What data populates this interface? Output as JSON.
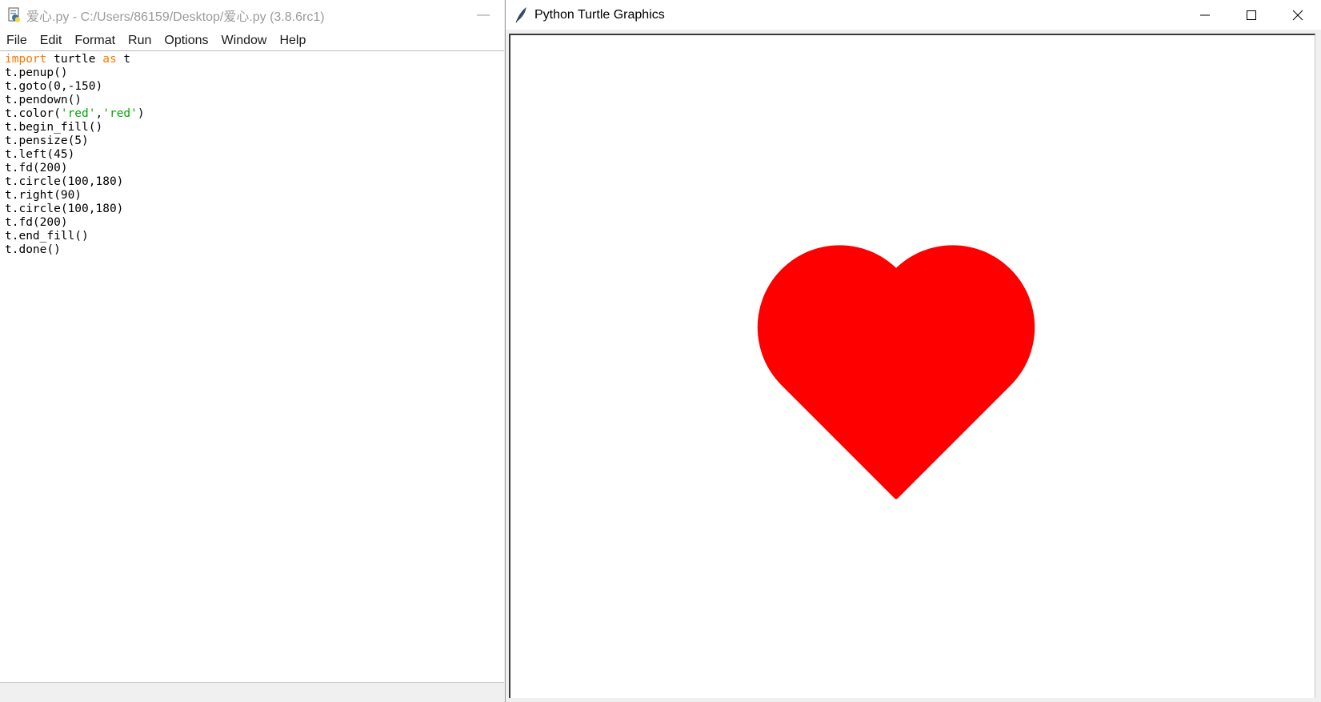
{
  "idle": {
    "window_title": "爱心.py - C:/Users/86159/Desktop/爱心.py (3.8.6rc1)",
    "minimize_glyph": "—",
    "menu": [
      "File",
      "Edit",
      "Format",
      "Run",
      "Options",
      "Window",
      "Help"
    ],
    "code": {
      "line1": {
        "kw1": "import",
        "mid": " turtle ",
        "kw2": "as",
        "end": " t"
      },
      "line2": "t.penup()",
      "line3": "t.goto(0,-150)",
      "line4": "t.pendown()",
      "line5": {
        "pre": "t.color(",
        "s1": "'red'",
        "comma": ",",
        "s2": "'red'",
        "post": ")"
      },
      "line6": "t.begin_fill()",
      "line7": "t.pensize(5)",
      "line8": "t.left(45)",
      "line9": "t.fd(200)",
      "line10": "t.circle(100,180)",
      "line11": "t.right(90)",
      "line12": "t.circle(100,180)",
      "line13": "t.fd(200)",
      "line14": "t.end_fill()",
      "line15": "t.done()"
    },
    "colors": {
      "keyword": "#ff7700",
      "string": "#00aa00"
    }
  },
  "turtle": {
    "window_title": "Python Turtle Graphics",
    "controls": {
      "minimize": "minimize-icon",
      "maximize": "maximize-icon",
      "close": "close-icon"
    },
    "drawing": {
      "shape": "heart",
      "fill_color": "#ff0000"
    }
  }
}
